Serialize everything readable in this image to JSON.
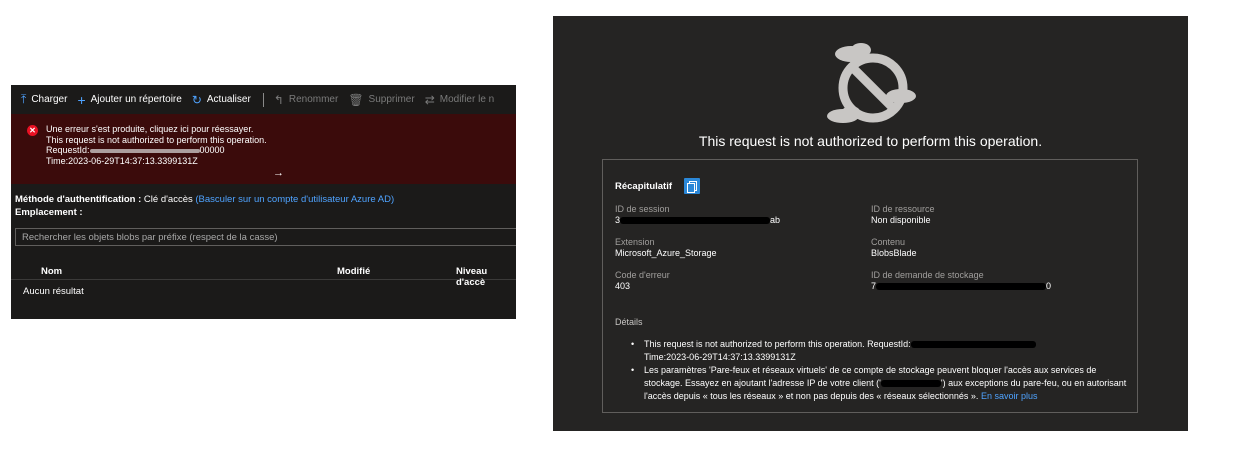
{
  "toolbar": {
    "upload": "Charger",
    "add_dir": "Ajouter un répertoire",
    "refresh": "Actualiser",
    "rename": "Renommer",
    "delete": "Supprimer",
    "modify": "Modifier le n"
  },
  "error": {
    "line1": "Une erreur s'est produite, cliquez ici pour réessayer.",
    "line2": "This request is not authorized to perform this operation.",
    "line3_prefix": "RequestId:",
    "line3_suffix": "00000",
    "line4": "Time:2023-06-29T14:37:13.3399131Z"
  },
  "auth": {
    "method_label": "Méthode d'authentification :",
    "method_value": "Clé d'accès",
    "switch_link": "(Basculer sur un compte d'utilisateur Azure AD)",
    "location_label": "Emplacement :"
  },
  "search": {
    "placeholder": "Rechercher les objets blobs par préfixe (respect de la casse)"
  },
  "table": {
    "col_name": "Nom",
    "col_modified": "Modifié",
    "col_tier": "Niveau d'accè",
    "empty": "Aucun résultat"
  },
  "dialog": {
    "headline": "This request is not authorized to perform this operation.",
    "summary_title": "Récapitulatif",
    "session_label": "ID de session",
    "session_value_prefix": "3",
    "session_value_suffix": "ab",
    "resource_label": "ID de ressource",
    "resource_value": "Non disponible",
    "extension_label": "Extension",
    "extension_value": "Microsoft_Azure_Storage",
    "content_label": "Contenu",
    "content_value": "BlobsBlade",
    "errcode_label": "Code d'erreur",
    "errcode_value": "403",
    "storage_req_label": "ID de demande de stockage",
    "storage_req_value_prefix": "7",
    "storage_req_value_suffix": "0",
    "details_label": "Détails",
    "bullet1_a": "This request is not authorized to perform this operation. RequestId:",
    "bullet1_b": "Time:2023-06-29T14:37:13.3399131Z",
    "bullet2_a": "Les paramètres 'Pare-feux et réseaux virtuels' de ce compte de stockage peuvent bloquer l'accès aux services de stockage. Essayez en ajoutant l'adresse IP de votre client ('",
    "bullet2_b": "') aux exceptions du pare-feu, ou en autorisant l'accès depuis « tous les réseaux » et non pas depuis des « réseaux sélectionnés ».",
    "learn_more": "En savoir plus"
  }
}
